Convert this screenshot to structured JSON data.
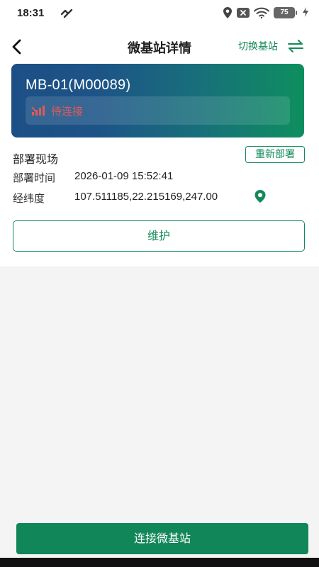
{
  "status_bar": {
    "time": "18:31",
    "battery": "75"
  },
  "nav": {
    "title": "微基站详情",
    "switch_label": "切换基站"
  },
  "station": {
    "name": "MB-01(M00089)",
    "connection_status": "待连接"
  },
  "deployment": {
    "section_title": "部署现场",
    "redeploy_label": "重新部署",
    "time_label": "部署时间",
    "time_value": "2026-01-09 15:52:41",
    "coords_label": "经纬度",
    "coords_value": "107.511185,22.215169,247.00"
  },
  "actions": {
    "maintain_label": "维护",
    "connect_label": "连接微基站"
  },
  "colors": {
    "accent": "#138a5a",
    "error": "#e05a5a",
    "card_gradient_start": "#1c4f86",
    "card_gradient_end": "#0e8f5f"
  },
  "icons": {
    "back": "chevron-left-icon",
    "switch": "swap-arrows-icon",
    "signal": "no-signal-icon",
    "location": "location-pin-icon"
  }
}
